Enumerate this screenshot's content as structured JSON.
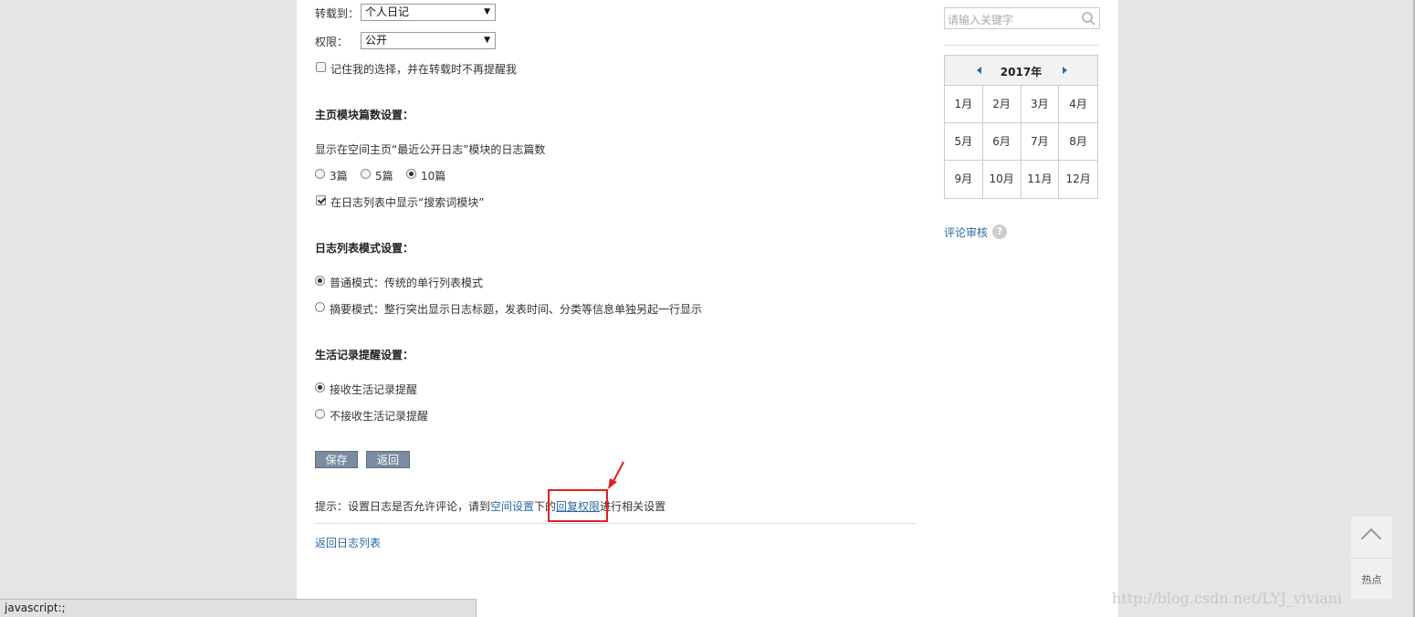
{
  "form": {
    "transfer_label": "转载到：",
    "transfer_value": "个人日记",
    "perm_label": "权限：",
    "perm_value": "公开",
    "remember_label": "记住我的选择，并在转载时不再提醒我",
    "remember_checked": false
  },
  "homepage": {
    "title": "主页模块篇数设置：",
    "desc": "显示在空间主页“最近公开日志”模块的日志篇数",
    "options": [
      "3篇",
      "5篇",
      "10篇"
    ],
    "selected": "10篇",
    "show_search_label": "在日志列表中显示“搜索词模块”",
    "show_search_checked": true
  },
  "listmode": {
    "title": "日志列表模式设置：",
    "normal": "普通模式：传统的单行列表模式",
    "summary": "摘要模式：整行突出显示日志标题，发表时间、分类等信息单独另起一行显示",
    "selected": "normal"
  },
  "life": {
    "title": "生活记录提醒设置：",
    "receive": "接收生活记录提醒",
    "reject": "不接收生活记录提醒",
    "selected": "receive"
  },
  "buttons": {
    "save": "保存",
    "back": "返回"
  },
  "tip": {
    "prefix": "提示：设置日志是否允许评论，请到",
    "link1": "空间设置",
    "mid": "下的",
    "link2": "回复权限",
    "suffix": "进行相关设置"
  },
  "back_link": "返回日志列表",
  "sidebar": {
    "search_placeholder": "请输入关键字",
    "calendar_year": "2017年",
    "months": [
      "1月",
      "2月",
      "3月",
      "4月",
      "5月",
      "6月",
      "7月",
      "8月",
      "9月",
      "10月",
      "11月",
      "12月"
    ],
    "review_link": "评论审核",
    "help": "?"
  },
  "totop_label": "热点",
  "status_text": "javascript:;",
  "watermark": "http://blog.csdn.net/LYJ_viviani",
  "colors": {
    "link": "#2b6aa3",
    "button": "#7a8c9f",
    "annotation": "#e02020"
  }
}
